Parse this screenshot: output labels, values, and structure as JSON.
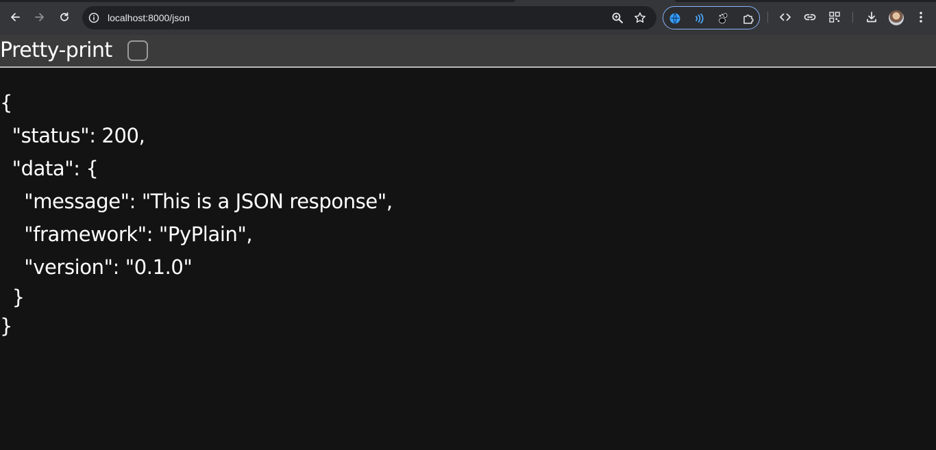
{
  "browser": {
    "url": "localhost:8000/json",
    "icons": {
      "back": "back-arrow-icon",
      "forward": "forward-arrow-icon",
      "reload": "reload-icon",
      "site_info": "site-info-icon",
      "zoom": "zoom-icon",
      "bookmark": "star-icon",
      "extensions": [
        "blue-globe-extension-icon",
        "wave-extension-icon",
        "gnome-extension-icon",
        "puzzle-extensions-icon"
      ],
      "toolbar": [
        "code-icon",
        "link-icon",
        "qr-code-icon",
        "download-icon",
        "avatar",
        "kebab-menu-icon"
      ]
    },
    "colors": {
      "toolbar_bg": "#35363a",
      "omnibox_bg": "#202124",
      "accent": "#8ab4f8"
    }
  },
  "page": {
    "pretty_print_label": "Pretty-print",
    "pretty_print_checked": false,
    "json_lines": [
      "{",
      "  \"status\": 200,",
      "  \"data\": {",
      "    \"message\": \"This is a JSON response\",",
      "    \"framework\": \"PyPlain\",",
      "    \"version\": \"0.1.0\"",
      "  }",
      "}"
    ],
    "colors": {
      "background": "#131313",
      "bar_bg": "#3b3b3b",
      "text": "#ffffff"
    }
  }
}
